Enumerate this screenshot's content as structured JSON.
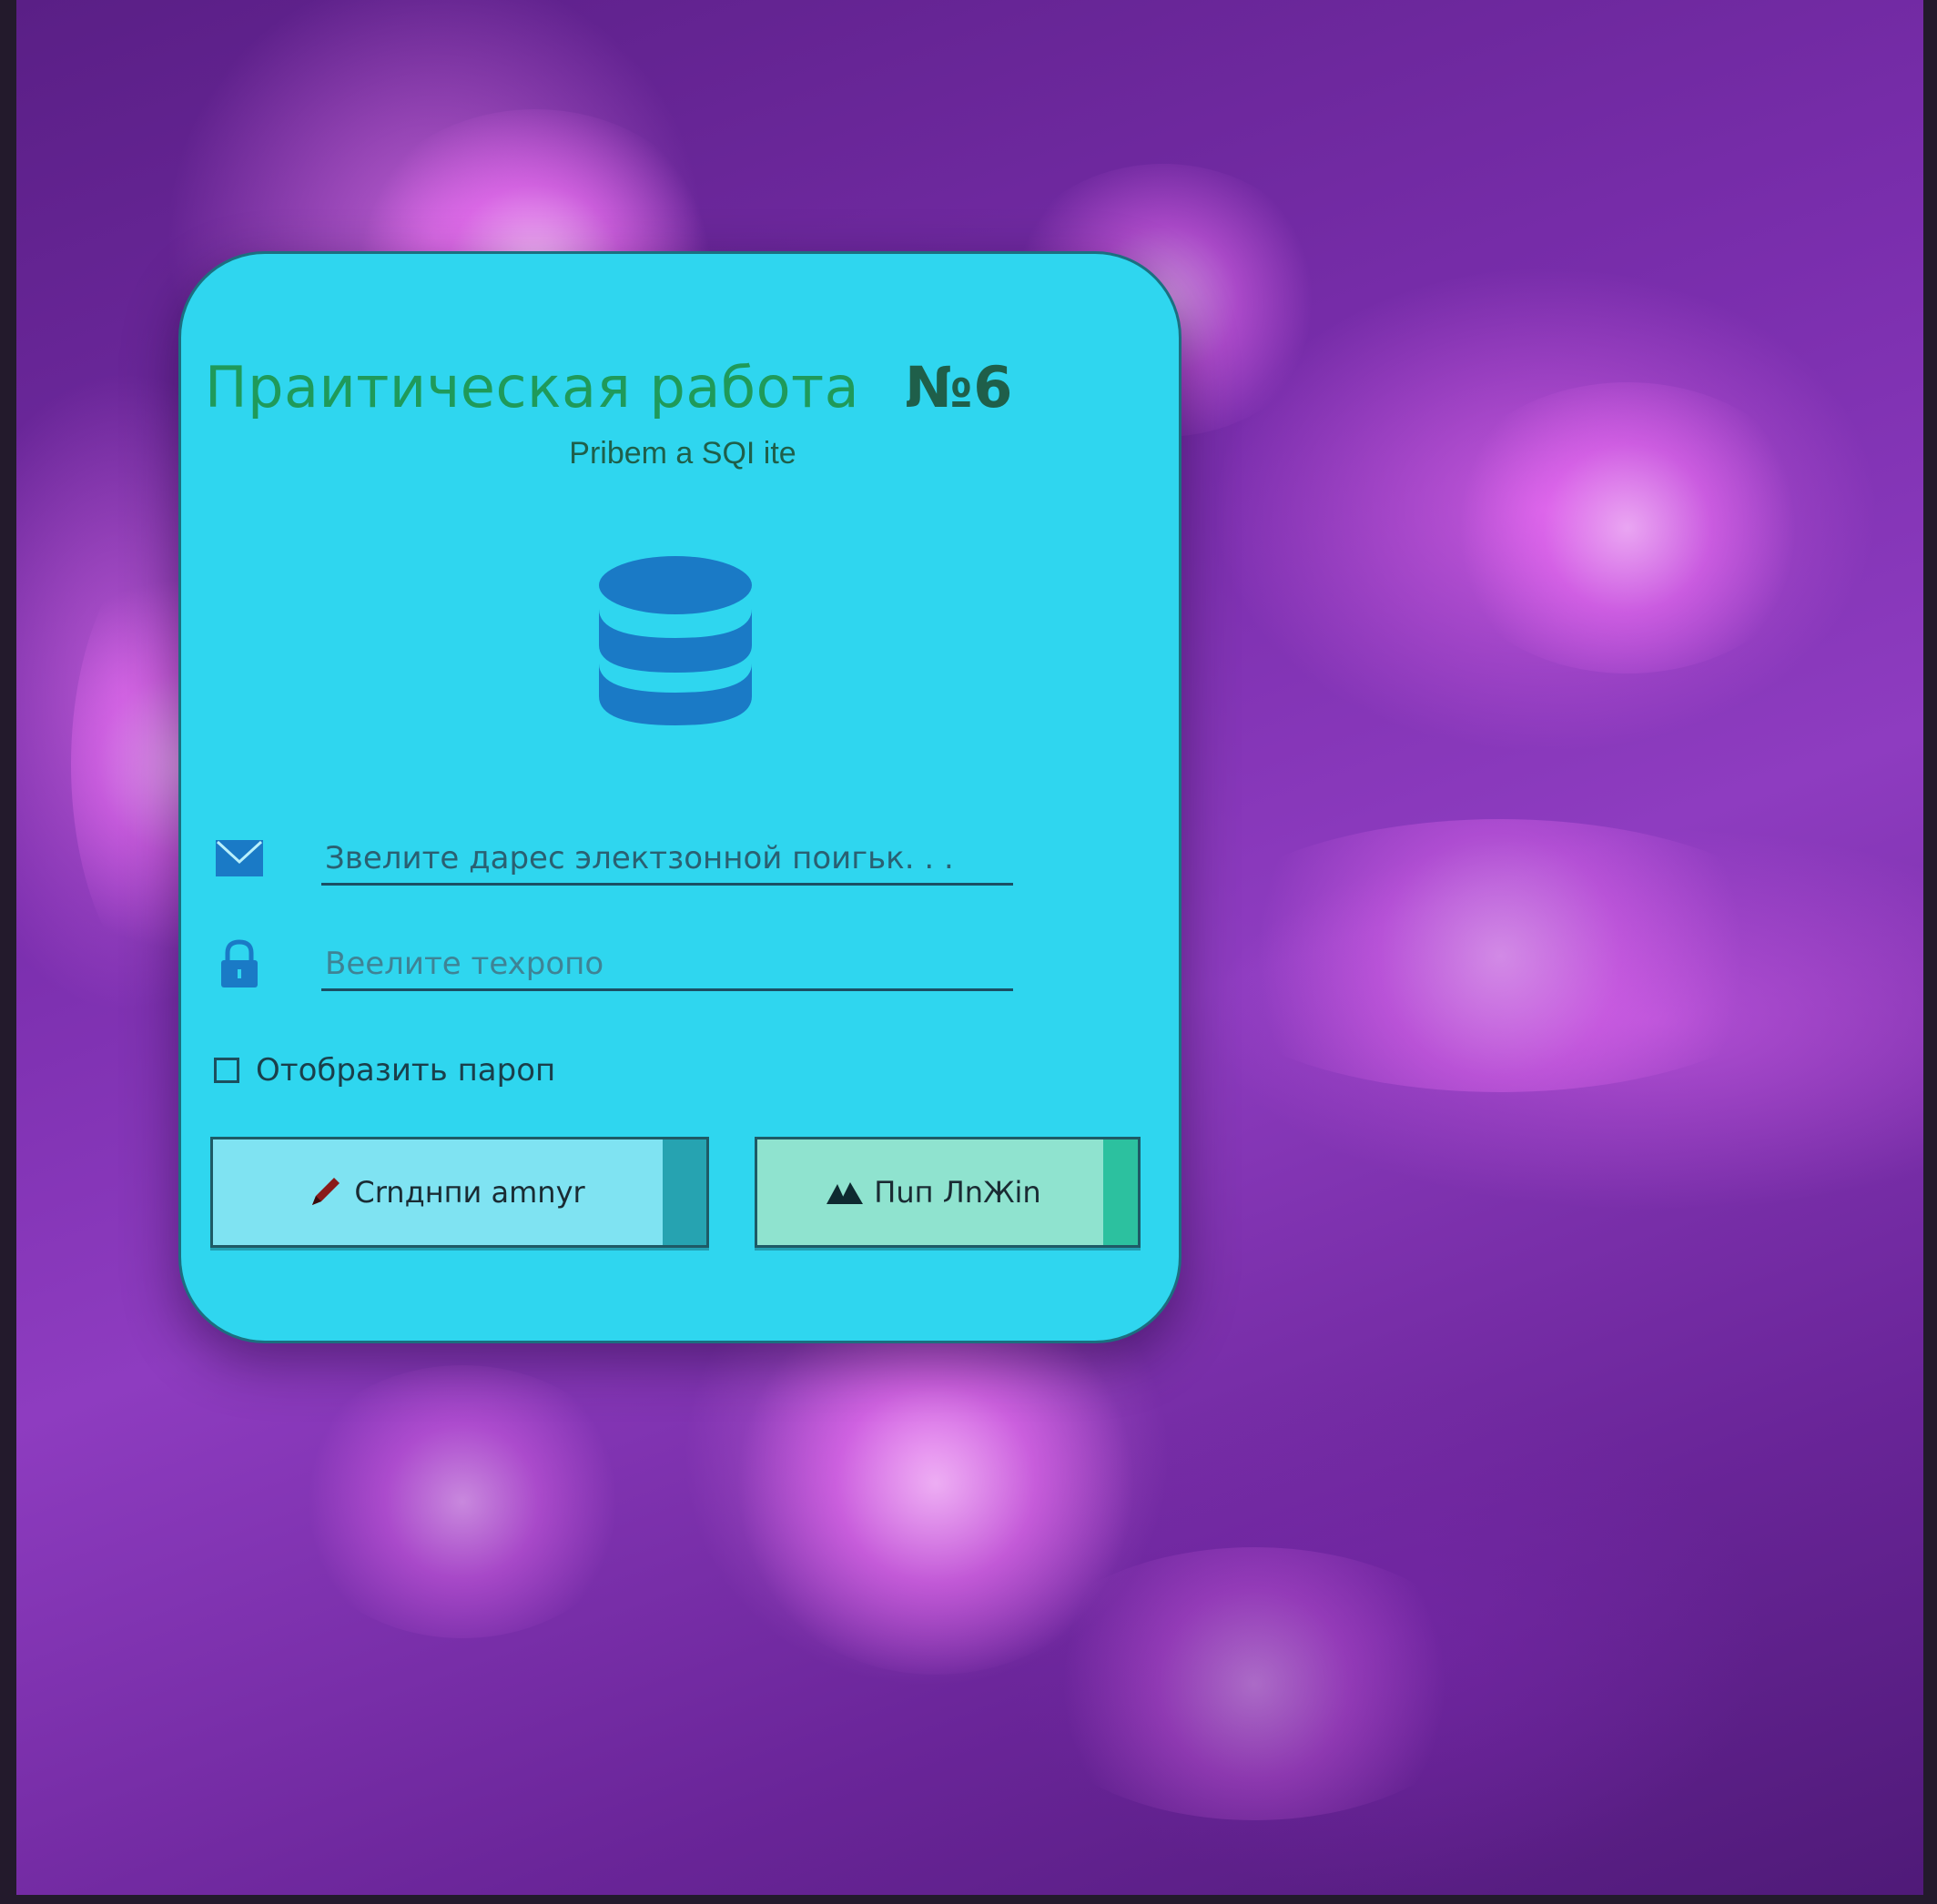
{
  "page": {
    "title": "Праитическая работа",
    "number": "№6",
    "subtitle": "Pribem a SQI ite"
  },
  "email_field": {
    "placeholder": "Звелите дарес электзонной поигьк. . .",
    "icon": "envelope-icon"
  },
  "password_field": {
    "placeholder": "Веелите тexpoпo",
    "icon": "lock-icon"
  },
  "show_password": {
    "label": "Отобразить пapоп",
    "checked": false
  },
  "buttons": {
    "create_label": "Crnднпи amnyr",
    "login_label": "Пuп ЛnЖin"
  },
  "colors": {
    "card_bg": "#2fd6ef",
    "title": "#1f9a5a",
    "icon_blue": "#1a7ac6",
    "create_button": "#7fe3f2",
    "login_button": "#8fe3cf"
  },
  "icons": {
    "hero": "database-icon",
    "create": "pencil-icon",
    "login": "mountain-icon"
  }
}
